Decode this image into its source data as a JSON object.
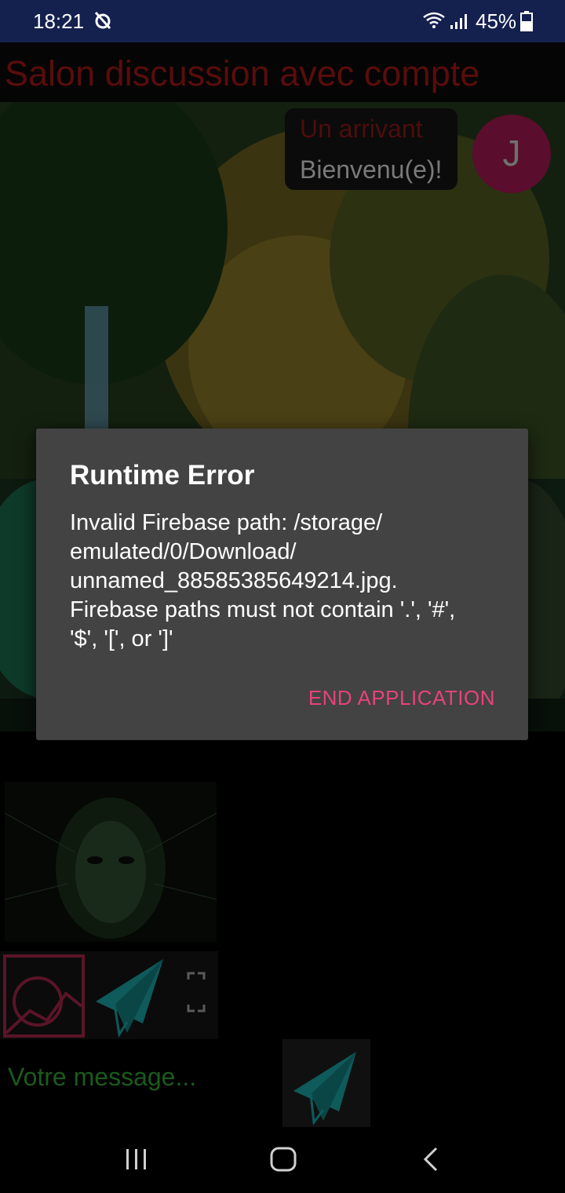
{
  "status_bar": {
    "time": "18:21",
    "battery": "45%",
    "icons": [
      "alarm-off-icon",
      "wifi-icon",
      "signal-icon",
      "battery-icon"
    ]
  },
  "app": {
    "title": "Salon discussion avec compte"
  },
  "chat": {
    "author": "Un arrivant",
    "message": "Bienvenu(e)!",
    "avatar_letter": "J"
  },
  "composer": {
    "placeholder": "Votre message..."
  },
  "dialog": {
    "title": "Runtime Error",
    "message_lines": [
      "Invalid Firebase path: /storage/",
      "emulated/0/Download/",
      "unnamed_885853856492​14.jpg.",
      "Firebase paths must not contain '.', '#',",
      "'$', '[', or ']'"
    ],
    "button": "END APPLICATION"
  },
  "colors": {
    "status_bar": "#14214f",
    "dialog_bg": "#434343",
    "accent": "#e8427a",
    "placeholder": "#1c5a1c"
  }
}
